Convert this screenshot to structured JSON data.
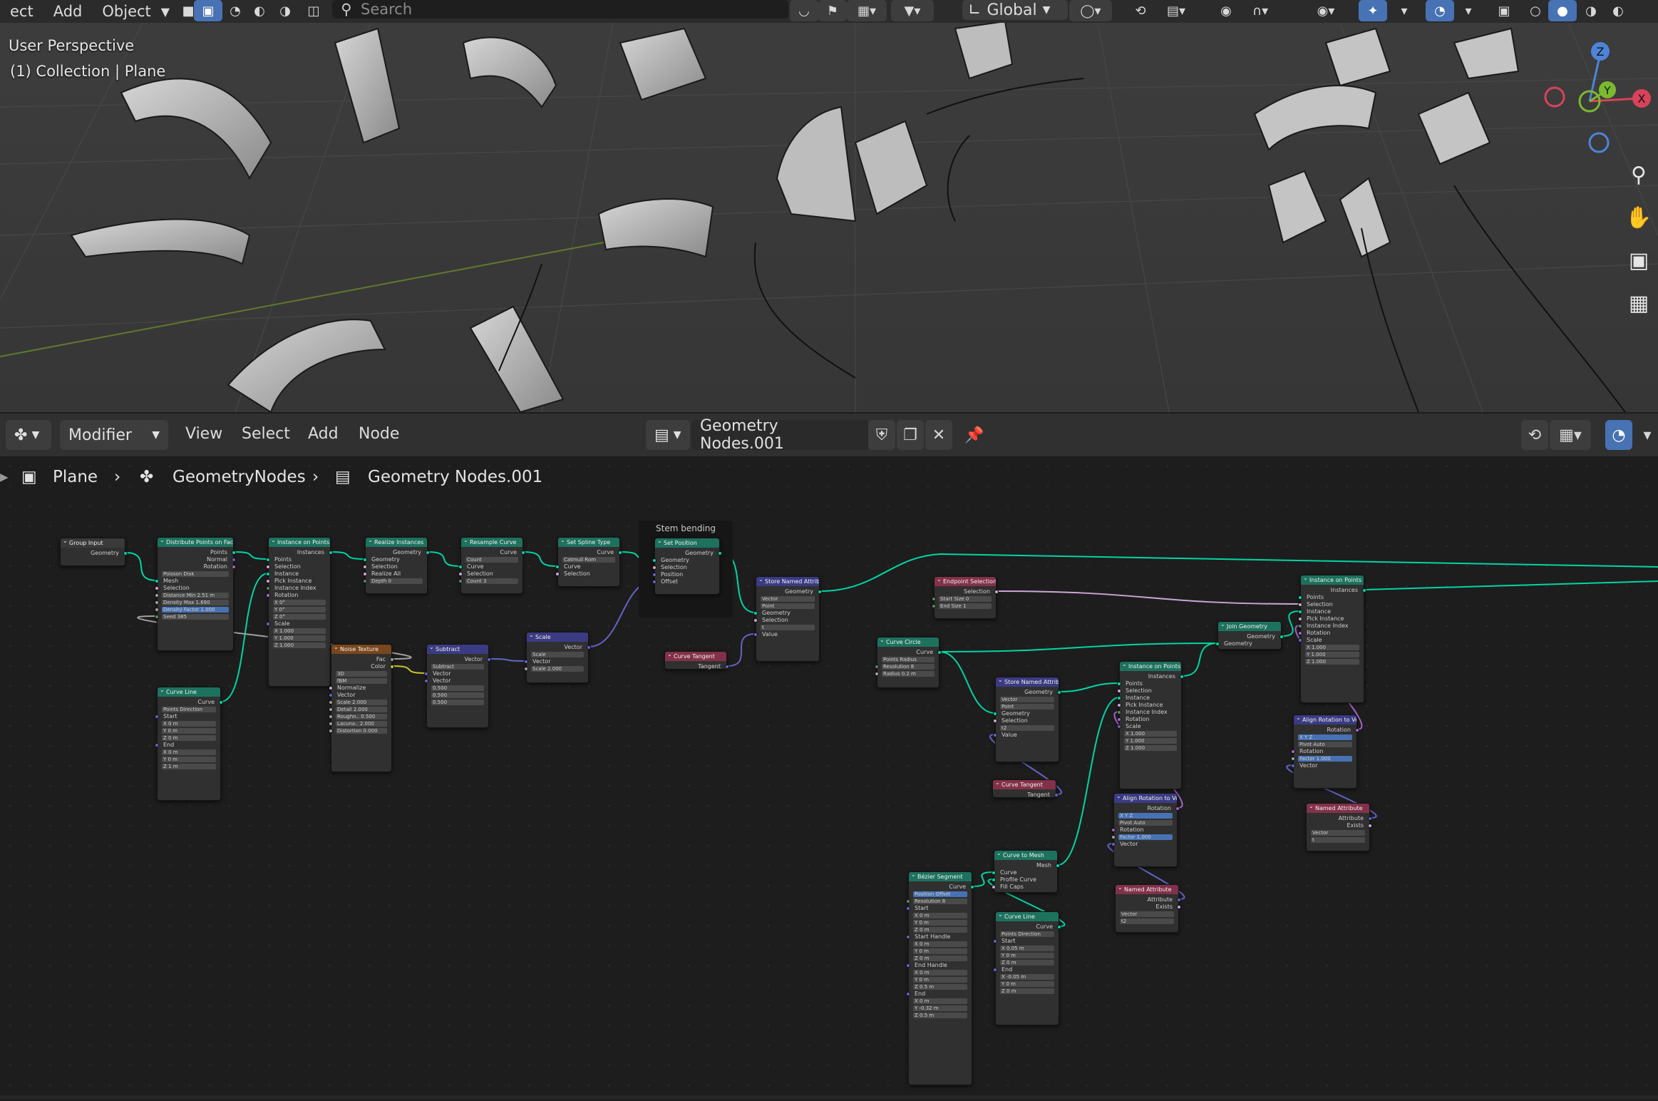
{
  "topbar": {
    "menu_items": [
      "ect",
      "Add",
      "Object"
    ],
    "search_placeholder": "Search",
    "transform_orientation": "Global"
  },
  "viewport": {
    "view_name": "User Perspective",
    "collection_label": "(1) Collection | Plane",
    "gizmo": {
      "z": "Z",
      "y": "Y",
      "x": "X"
    }
  },
  "node_editor": {
    "editor_type": "Modifier",
    "menus": [
      "View",
      "Select",
      "Add",
      "Node"
    ],
    "node_group_name": "Geometry Nodes.001",
    "breadcrumb": [
      "Plane",
      "GeometryNodes",
      "Geometry Nodes.001"
    ],
    "frame_label": "Stem bending"
  },
  "nodes": [
    {
      "id": "group_input",
      "title": "Group Input",
      "header": "input",
      "rows": [
        {
          "t": "Geometry",
          "o": true,
          "s": "geo"
        }
      ]
    },
    {
      "id": "distribute",
      "title": "Distribute Points on Faces",
      "header": "geo",
      "rows": [
        {
          "t": "Points",
          "o": true,
          "s": "geo"
        },
        {
          "t": "Normal",
          "o": true,
          "s": "vec"
        },
        {
          "t": "Rotation",
          "o": true,
          "s": "rot"
        },
        {
          "t": "Poisson Disk",
          "f": true
        },
        {
          "t": "Mesh",
          "s": "geo"
        },
        {
          "t": "Selection",
          "s": "bool"
        },
        {
          "t": "Distance Min   2.51 m",
          "f": true,
          "s": "flt"
        },
        {
          "t": "Density Max    1.690",
          "f": true,
          "s": "flt"
        },
        {
          "t": "Density Factor   1.000",
          "f": "blue",
          "s": "flt"
        },
        {
          "t": "Seed          385",
          "f": true,
          "s": "int"
        }
      ]
    },
    {
      "id": "instance_pts_1",
      "title": "Instance on Points",
      "header": "geo",
      "rows": [
        {
          "t": "Instances",
          "o": true,
          "s": "geo"
        },
        {
          "t": "Points",
          "s": "geo"
        },
        {
          "t": "Selection",
          "s": "bool"
        },
        {
          "t": "Instance",
          "s": "geo"
        },
        {
          "t": "Pick Instance",
          "s": "bool"
        },
        {
          "t": "Instance Index",
          "s": "int"
        },
        {
          "t": "Rotation",
          "s": "rot"
        },
        {
          "t": "X   0°",
          "f": true
        },
        {
          "t": "Y   0°",
          "f": true
        },
        {
          "t": "Z   0°",
          "f": true
        },
        {
          "t": "Scale",
          "s": "vec"
        },
        {
          "t": "X   1.000",
          "f": true
        },
        {
          "t": "Y   1.000",
          "f": true
        },
        {
          "t": "Z   1.000",
          "f": true
        }
      ]
    },
    {
      "id": "realize",
      "title": "Realize Instances",
      "header": "geo",
      "rows": [
        {
          "t": "Geometry",
          "o": true,
          "s": "geo"
        },
        {
          "t": "Geometry",
          "s": "geo"
        },
        {
          "t": "Selection",
          "s": "bool"
        },
        {
          "t": "Realize All",
          "s": "bool"
        },
        {
          "t": "Depth     0",
          "f": true,
          "s": "int"
        }
      ]
    },
    {
      "id": "resample",
      "title": "Resample Curve",
      "header": "geo",
      "rows": [
        {
          "t": "Curve",
          "o": true,
          "s": "geo"
        },
        {
          "t": "Count",
          "f": true
        },
        {
          "t": "Curve",
          "s": "geo"
        },
        {
          "t": "Selection",
          "s": "bool"
        },
        {
          "t": "Count     3",
          "f": true,
          "s": "int"
        }
      ]
    },
    {
      "id": "spline_type",
      "title": "Set Spline Type",
      "header": "geo",
      "rows": [
        {
          "t": "Curve",
          "o": true,
          "s": "geo"
        },
        {
          "t": "Catmull Rom",
          "f": true
        },
        {
          "t": "Curve",
          "s": "geo"
        },
        {
          "t": "Selection",
          "s": "bool"
        }
      ]
    },
    {
      "id": "set_position",
      "title": "Set Position",
      "header": "geo",
      "rows": [
        {
          "t": "Geometry",
          "o": true,
          "s": "geo"
        },
        {
          "t": "Geometry",
          "s": "geo"
        },
        {
          "t": "Selection",
          "s": "bool"
        },
        {
          "t": "Position",
          "s": "vec"
        },
        {
          "t": "Offset",
          "s": "vec"
        }
      ]
    },
    {
      "id": "curve_line_1",
      "title": "Curve Line",
      "header": "geo",
      "rows": [
        {
          "t": "Curve",
          "o": true,
          "s": "geo"
        },
        {
          "t": "Points   Direction",
          "f": true
        },
        {
          "t": "Start",
          "s": "vec"
        },
        {
          "t": "X   0 m",
          "f": true
        },
        {
          "t": "Y   0 m",
          "f": true
        },
        {
          "t": "Z   0 m",
          "f": true
        },
        {
          "t": "End",
          "s": "vec"
        },
        {
          "t": "X   0 m",
          "f": true
        },
        {
          "t": "Y   0 m",
          "f": true
        },
        {
          "t": "Z   1 m",
          "f": true
        }
      ]
    },
    {
      "id": "noise",
      "title": "Noise Texture",
      "header": "tex",
      "rows": [
        {
          "t": "Fac",
          "o": true,
          "s": "flt"
        },
        {
          "t": "Color",
          "o": true,
          "s": "col"
        },
        {
          "t": "3D",
          "f": true
        },
        {
          "t": "fBM",
          "f": true
        },
        {
          "t": "Normalize",
          "s": "bool"
        },
        {
          "t": "Vector",
          "s": "vec"
        },
        {
          "t": "Scale   2.000",
          "f": true,
          "s": "flt"
        },
        {
          "t": "Detail   2.000",
          "f": true,
          "s": "flt"
        },
        {
          "t": "Roughn..  0.500",
          "f": true,
          "s": "flt"
        },
        {
          "t": "Lacuna..  2.000",
          "f": true,
          "s": "flt"
        },
        {
          "t": "Distortion  0.000",
          "f": true,
          "s": "flt"
        }
      ]
    },
    {
      "id": "subtract",
      "title": "Subtract",
      "header": "vec",
      "rows": [
        {
          "t": "Vector",
          "o": true,
          "s": "vec"
        },
        {
          "t": "Subtract",
          "f": true
        },
        {
          "t": "Vector",
          "s": "vec"
        },
        {
          "t": "Vector",
          "s": "vec"
        },
        {
          "t": "0.500",
          "f": true
        },
        {
          "t": "0.500",
          "f": true
        },
        {
          "t": "0.500",
          "f": true
        }
      ]
    },
    {
      "id": "scale",
      "title": "Scale",
      "header": "vec",
      "rows": [
        {
          "t": "Vector",
          "o": true,
          "s": "vec"
        },
        {
          "t": "Scale",
          "f": true
        },
        {
          "t": "Vector",
          "s": "vec"
        },
        {
          "t": "Scale   2.000",
          "f": true,
          "s": "flt"
        }
      ]
    },
    {
      "id": "curve_tangent_1",
      "title": "Curve Tangent",
      "header": "attr",
      "rows": [
        {
          "t": "Tangent",
          "o": true,
          "s": "vec"
        }
      ]
    },
    {
      "id": "store_named_1",
      "title": "Store Named Attribute",
      "header": "vec",
      "rows": [
        {
          "t": "Geometry",
          "o": true,
          "s": "geo"
        },
        {
          "t": "Vector",
          "f": true
        },
        {
          "t": "Point",
          "f": true
        },
        {
          "t": "Geometry",
          "s": "geo"
        },
        {
          "t": "Selection",
          "s": "bool"
        },
        {
          "t": "t",
          "f": true
        },
        {
          "t": "Value",
          "s": "vec"
        }
      ]
    },
    {
      "id": "endpoint_sel",
      "title": "Endpoint Selection",
      "header": "attr",
      "rows": [
        {
          "t": "Selection",
          "o": true,
          "s": "bool"
        },
        {
          "t": "Start Size    0",
          "f": true,
          "s": "int"
        },
        {
          "t": "End Size      1",
          "f": true,
          "s": "int"
        }
      ]
    },
    {
      "id": "curve_circle",
      "title": "Curve Circle",
      "header": "geo",
      "rows": [
        {
          "t": "Curve",
          "o": true,
          "s": "geo"
        },
        {
          "t": "Points   Radius",
          "f": true
        },
        {
          "t": "Resolution   8",
          "f": true,
          "s": "int"
        },
        {
          "t": "Radius   0.2 m",
          "f": true,
          "s": "flt"
        }
      ]
    },
    {
      "id": "store_named_2",
      "title": "Store Named Attrib...",
      "header": "vec",
      "rows": [
        {
          "t": "Geometry",
          "o": true,
          "s": "geo"
        },
        {
          "t": "Vector",
          "f": true
        },
        {
          "t": "Point",
          "f": true
        },
        {
          "t": "Geometry",
          "s": "geo"
        },
        {
          "t": "Selection",
          "s": "bool"
        },
        {
          "t": "t2",
          "f": true
        },
        {
          "t": "Value",
          "s": "vec"
        }
      ]
    },
    {
      "id": "curve_tangent_2",
      "title": "Curve Tangent",
      "header": "attr",
      "rows": [
        {
          "t": "Tangent",
          "o": true,
          "s": "vec"
        }
      ]
    },
    {
      "id": "join_geo",
      "title": "Join Geometry",
      "header": "geo",
      "rows": [
        {
          "t": "Geometry",
          "o": true,
          "s": "geo"
        },
        {
          "t": "Geometry",
          "s": "geo"
        }
      ]
    },
    {
      "id": "instance_pts_2",
      "title": "Instance on Points",
      "header": "geo",
      "rows": [
        {
          "t": "Instances",
          "o": true,
          "s": "geo"
        },
        {
          "t": "Points",
          "s": "geo"
        },
        {
          "t": "Selection",
          "s": "bool"
        },
        {
          "t": "Instance",
          "s": "geo"
        },
        {
          "t": "Pick Instance",
          "s": "bool"
        },
        {
          "t": "Instance Index",
          "s": "int"
        },
        {
          "t": "Rotation",
          "s": "rot"
        },
        {
          "t": "Scale",
          "s": "vec"
        },
        {
          "t": "X   1.000",
          "f": true
        },
        {
          "t": "Y   1.000",
          "f": true
        },
        {
          "t": "Z   1.000",
          "f": true
        }
      ]
    },
    {
      "id": "instance_pts_3",
      "title": "Instance on Points",
      "header": "geo",
      "rows": [
        {
          "t": "Instances",
          "o": true,
          "s": "geo"
        },
        {
          "t": "Points",
          "s": "geo"
        },
        {
          "t": "Selection",
          "s": "bool"
        },
        {
          "t": "Instance",
          "s": "geo"
        },
        {
          "t": "Pick Instance",
          "s": "bool"
        },
        {
          "t": "Instance Index",
          "s": "int"
        },
        {
          "t": "Rotation",
          "s": "rot"
        },
        {
          "t": "Scale",
          "s": "vec"
        },
        {
          "t": "X   1.000",
          "f": true
        },
        {
          "t": "Y   1.000",
          "f": true
        },
        {
          "t": "Z   1.000",
          "f": true
        }
      ]
    },
    {
      "id": "align_rot_1",
      "title": "Align Rotation to Ve...",
      "header": "vec",
      "rows": [
        {
          "t": "Rotation",
          "o": true,
          "s": "rot"
        },
        {
          "t": "X   Y   Z",
          "f": "blue"
        },
        {
          "t": "Pivot    Auto",
          "f": true
        },
        {
          "t": "Rotation",
          "s": "rot"
        },
        {
          "t": "Factor   1.000",
          "f": "blue",
          "s": "flt"
        },
        {
          "t": "Vector",
          "s": "vec"
        }
      ]
    },
    {
      "id": "align_rot_2",
      "title": "Align Rotation to Ve...",
      "header": "vec",
      "rows": [
        {
          "t": "Rotation",
          "o": true,
          "s": "rot"
        },
        {
          "t": "X   Y   Z",
          "f": "blue"
        },
        {
          "t": "Pivot    Auto",
          "f": true
        },
        {
          "t": "Rotation",
          "s": "rot"
        },
        {
          "t": "Factor   1.000",
          "f": "blue",
          "s": "flt"
        },
        {
          "t": "Vector",
          "s": "vec"
        }
      ]
    },
    {
      "id": "named_attr_1",
      "title": "Named Attribute",
      "header": "attr",
      "rows": [
        {
          "t": "Attribute",
          "o": true,
          "s": "vec"
        },
        {
          "t": "Exists",
          "o": true,
          "s": "bool"
        },
        {
          "t": "Vector",
          "f": true
        },
        {
          "t": "t",
          "f": true
        }
      ]
    },
    {
      "id": "named_attr_2",
      "title": "Named Attribute",
      "header": "attr",
      "rows": [
        {
          "t": "Attribute",
          "o": true,
          "s": "vec"
        },
        {
          "t": "Exists",
          "o": true,
          "s": "bool"
        },
        {
          "t": "Vector",
          "f": true
        },
        {
          "t": "t2",
          "f": true
        }
      ]
    },
    {
      "id": "curve_to_mesh",
      "title": "Curve to Mesh",
      "header": "geo",
      "rows": [
        {
          "t": "Mesh",
          "o": true,
          "s": "geo"
        },
        {
          "t": "Curve",
          "s": "geo"
        },
        {
          "t": "Profile Curve",
          "s": "geo"
        },
        {
          "t": "Fill Caps",
          "s": "bool"
        }
      ]
    },
    {
      "id": "bezier",
      "title": "Bézier Segment",
      "header": "geo",
      "rows": [
        {
          "t": "Curve",
          "o": true,
          "s": "geo"
        },
        {
          "t": "Position   Offset",
          "f": "blue"
        },
        {
          "t": "Resolution   8",
          "f": true,
          "s": "int"
        },
        {
          "t": "Start",
          "s": "vec"
        },
        {
          "t": "X   0 m",
          "f": true
        },
        {
          "t": "Y   0 m",
          "f": true
        },
        {
          "t": "Z   0 m",
          "f": true
        },
        {
          "t": "Start Handle",
          "s": "vec"
        },
        {
          "t": "X   0 m",
          "f": true
        },
        {
          "t": "Y   0 m",
          "f": true
        },
        {
          "t": "Z   0 m",
          "f": true
        },
        {
          "t": "End Handle",
          "s": "vec"
        },
        {
          "t": "X   0 m",
          "f": true
        },
        {
          "t": "Y   0 m",
          "f": true
        },
        {
          "t": "Z   0.5 m",
          "f": true
        },
        {
          "t": "End",
          "s": "vec"
        },
        {
          "t": "X   0 m",
          "f": true
        },
        {
          "t": "Y   -0.32 m",
          "f": true
        },
        {
          "t": "Z   0.5 m",
          "f": true
        }
      ]
    },
    {
      "id": "curve_line_2",
      "title": "Curve Line",
      "header": "geo",
      "rows": [
        {
          "t": "Curve",
          "o": true,
          "s": "geo"
        },
        {
          "t": "Points   Direction",
          "f": true
        },
        {
          "t": "Start",
          "s": "vec"
        },
        {
          "t": "X   0.05 m",
          "f": true
        },
        {
          "t": "Y   0 m",
          "f": true
        },
        {
          "t": "Z   0 m",
          "f": true
        },
        {
          "t": "End",
          "s": "vec"
        },
        {
          "t": "X   -0.05 m",
          "f": true
        },
        {
          "t": "Y   0 m",
          "f": true
        },
        {
          "t": "Z   0 m",
          "f": true
        }
      ]
    }
  ],
  "colors": {
    "geometry_header": "#1d725e",
    "texture_header": "#79461d",
    "vector_header": "#3b3b83",
    "attribute_header": "#83314a",
    "geometry_link": "#00d6a3",
    "accent": "#4772b3"
  },
  "icons": [
    "search-icon",
    "editor-type-icon",
    "shield-icon",
    "duplicate-icon",
    "close-icon",
    "pin-icon",
    "zoom-icon",
    "hand-icon",
    "camera-icon",
    "grid-icon",
    "snap-icon",
    "overlay-icon"
  ]
}
